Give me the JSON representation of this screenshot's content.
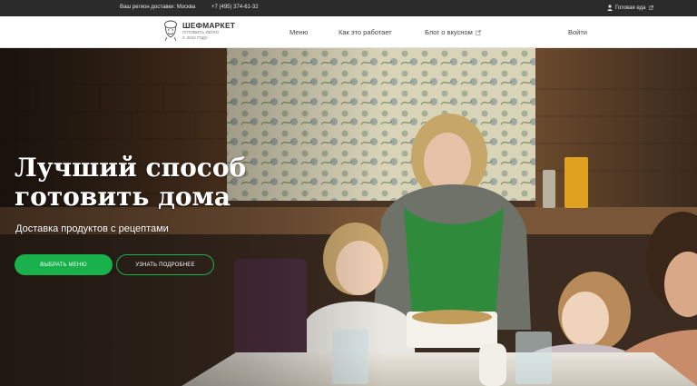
{
  "topbar": {
    "region_text": "Ваш регион доставки: Москва",
    "phone": "+7 (495) 374-61-32",
    "ready_food": "Готовая еда",
    "ready_food_icon": "user-icon",
    "external_icon": "external-link-icon"
  },
  "nav": {
    "logo_brand": "ШЕФМАРКЕТ",
    "logo_tagline_1": "ГОТОВИТЬ ЛЕГКО",
    "logo_tagline_2": "С 2012 ГОДА",
    "items": [
      {
        "label": "Меню"
      },
      {
        "label": "Как это работает"
      },
      {
        "label": "Блог о вкусном"
      }
    ],
    "login": "Войти"
  },
  "hero": {
    "title_line_1": "Лучший способ",
    "title_line_2": "готовить дома",
    "subtitle": "Доставка продуктов с рецептами",
    "cta_primary": "ВЫБРАТЬ МЕНЮ",
    "cta_secondary": "УЗНАТЬ ПОДРОБНЕЕ"
  },
  "colors": {
    "accent": "#19b14b",
    "topbar_bg": "#2b2b2b",
    "nav_bg": "#ffffff"
  }
}
